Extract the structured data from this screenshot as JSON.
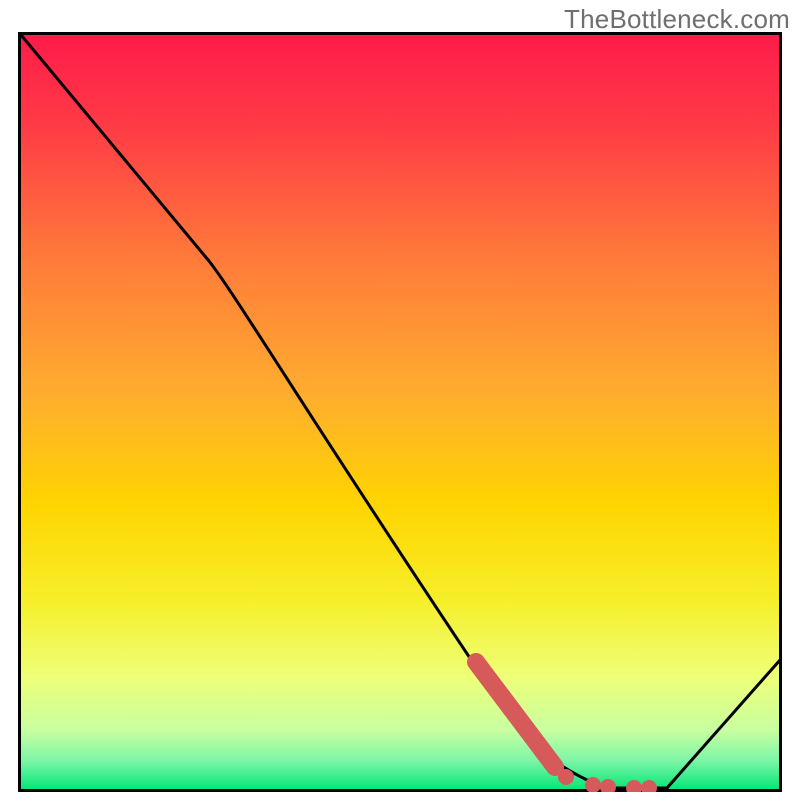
{
  "watermark": "TheBottleneck.com",
  "colors": {
    "top": "#ff1b4a",
    "mid": "#ffd400",
    "nearBottom": "#f2ff6c",
    "bottom": "#00e676",
    "border": "#000000",
    "curve": "#000000",
    "marker": "#d65a5a"
  },
  "chart_data": {
    "type": "line",
    "title": "",
    "xlabel": "",
    "ylabel": "",
    "xlim": [
      0,
      100
    ],
    "ylim": [
      0,
      100
    ],
    "x": [
      0,
      25,
      62,
      70,
      77,
      85,
      100
    ],
    "y": [
      100,
      70,
      13,
      3,
      0,
      0,
      17
    ],
    "series": [
      {
        "name": "curve",
        "x": [
          0,
          25,
          62,
          70,
          77,
          85,
          100
        ],
        "y": [
          100,
          70,
          13,
          3,
          0,
          0,
          17
        ]
      }
    ],
    "markers": {
      "thick_segment": {
        "x0": 60,
        "y0": 17,
        "x1": 70,
        "y1": 3
      },
      "dots": [
        {
          "x": 71.5,
          "y": 1.5
        },
        {
          "x": 75,
          "y": 0.5
        },
        {
          "x": 77,
          "y": 0.3
        },
        {
          "x": 80.5,
          "y": 0.2
        },
        {
          "x": 82.5,
          "y": 0.2
        }
      ]
    }
  }
}
